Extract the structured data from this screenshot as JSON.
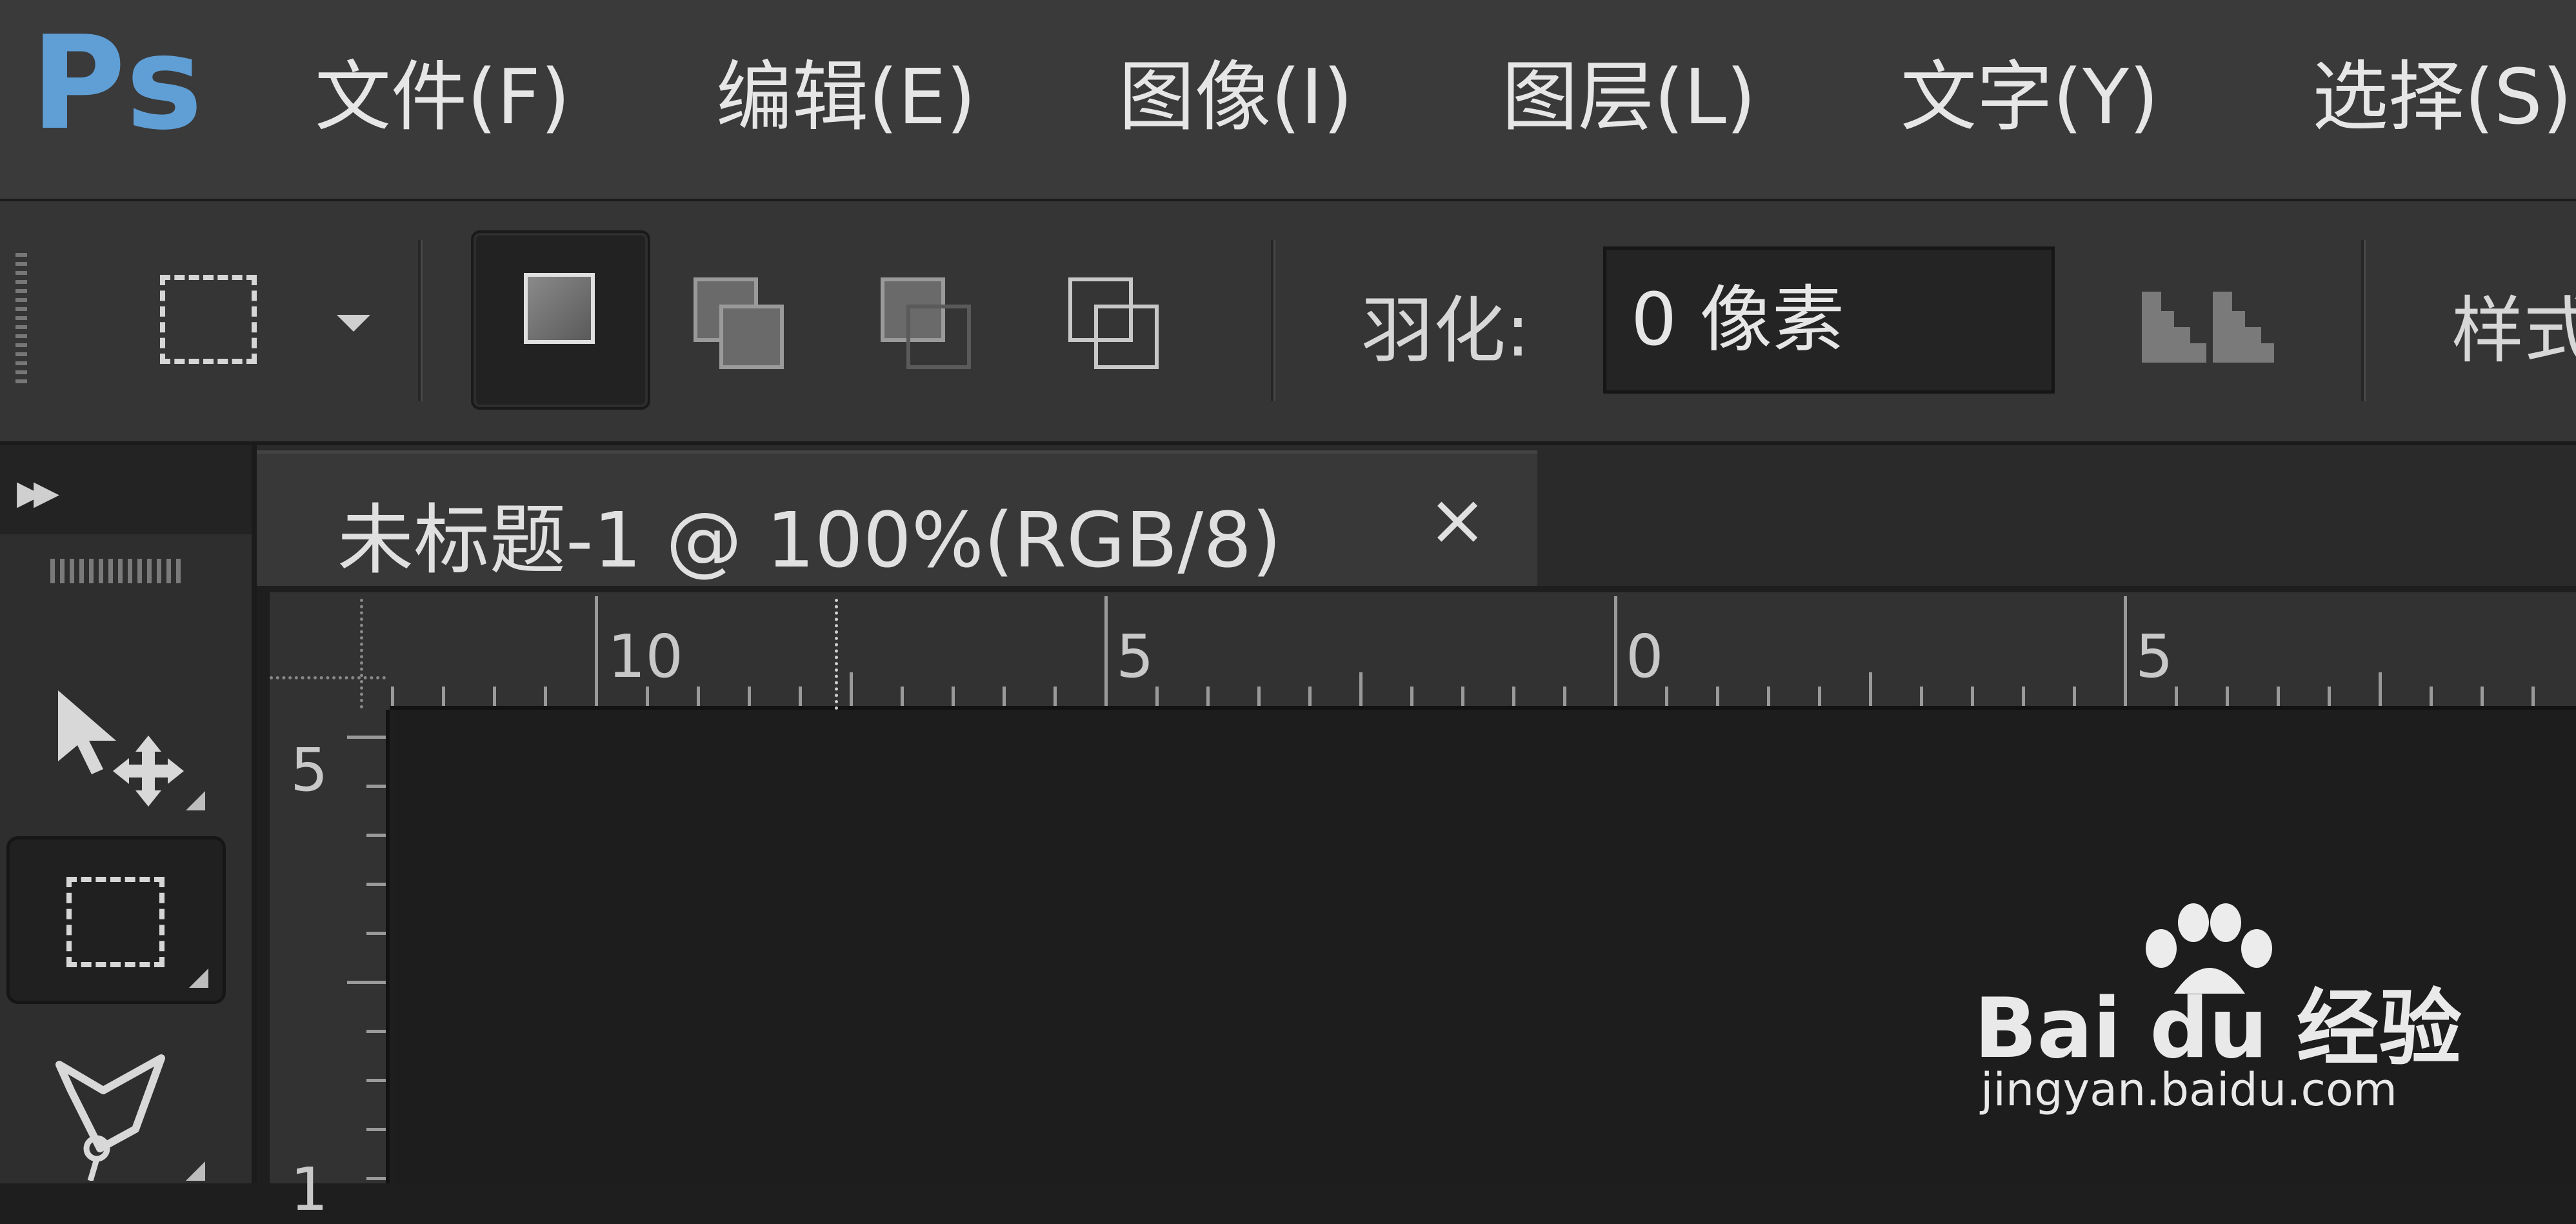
{
  "app": {
    "logo": "Ps"
  },
  "menu": [
    {
      "label": "文件(F)"
    },
    {
      "label": "编辑(E)"
    },
    {
      "label": "图像(I)"
    },
    {
      "label": "图层(L)"
    },
    {
      "label": "文字(Y)"
    },
    {
      "label": "选择(S)"
    }
  ],
  "options_bar": {
    "feather_label": "羽化:",
    "feather_value": "0 像素",
    "style_label": "样式"
  },
  "document": {
    "tab_title": "未标题-1 @ 100%(RGB/8)",
    "close_glyph": "×"
  },
  "rulers": {
    "horizontal_labels": [
      "10",
      "5",
      "0",
      "5"
    ],
    "vertical_labels": [
      "5",
      "1"
    ]
  },
  "watermark": {
    "brand": "Bai du 经验",
    "url": "jingyan.baidu.com"
  },
  "colors": {
    "logo_blue": "#5f9fd6",
    "menubar_bg": "#3a3a3a",
    "canvas_bg": "#1d1d1d"
  }
}
